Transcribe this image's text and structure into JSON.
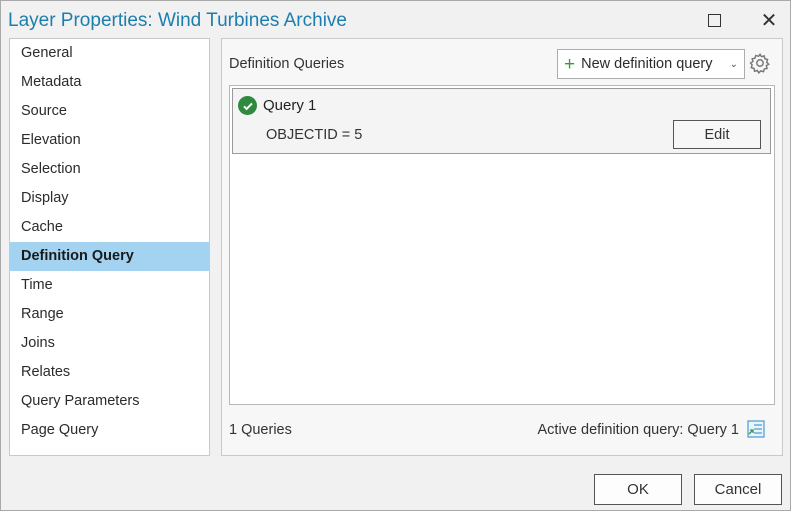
{
  "window": {
    "title": "Layer Properties: Wind Turbines Archive",
    "maximize_icon": "maximize-icon",
    "close_glyph": "✕"
  },
  "sidebar": {
    "items": [
      {
        "label": "General"
      },
      {
        "label": "Metadata"
      },
      {
        "label": "Source"
      },
      {
        "label": "Elevation"
      },
      {
        "label": "Selection"
      },
      {
        "label": "Display"
      },
      {
        "label": "Cache"
      },
      {
        "label": "Definition Query",
        "active": true
      },
      {
        "label": "Time"
      },
      {
        "label": "Range"
      },
      {
        "label": "Joins"
      },
      {
        "label": "Relates"
      },
      {
        "label": "Query Parameters"
      },
      {
        "label": "Page Query"
      }
    ]
  },
  "main": {
    "section_label": "Definition Queries",
    "new_query_button": {
      "plus": "+",
      "label": "New definition query",
      "chevron": "⌄"
    },
    "queries": [
      {
        "name": "Query 1",
        "expression": "OBJECTID = 5",
        "edit_label": "Edit",
        "status": "active"
      }
    ],
    "count_label": "1 Queries",
    "active_label": "Active definition query: Query 1"
  },
  "footer": {
    "ok_label": "OK",
    "cancel_label": "Cancel"
  },
  "colors": {
    "title": "#1d7eae",
    "selected_nav": "#a3d3f1",
    "check_green": "#2e8b3e",
    "plus_green": "#3a9a3a"
  }
}
